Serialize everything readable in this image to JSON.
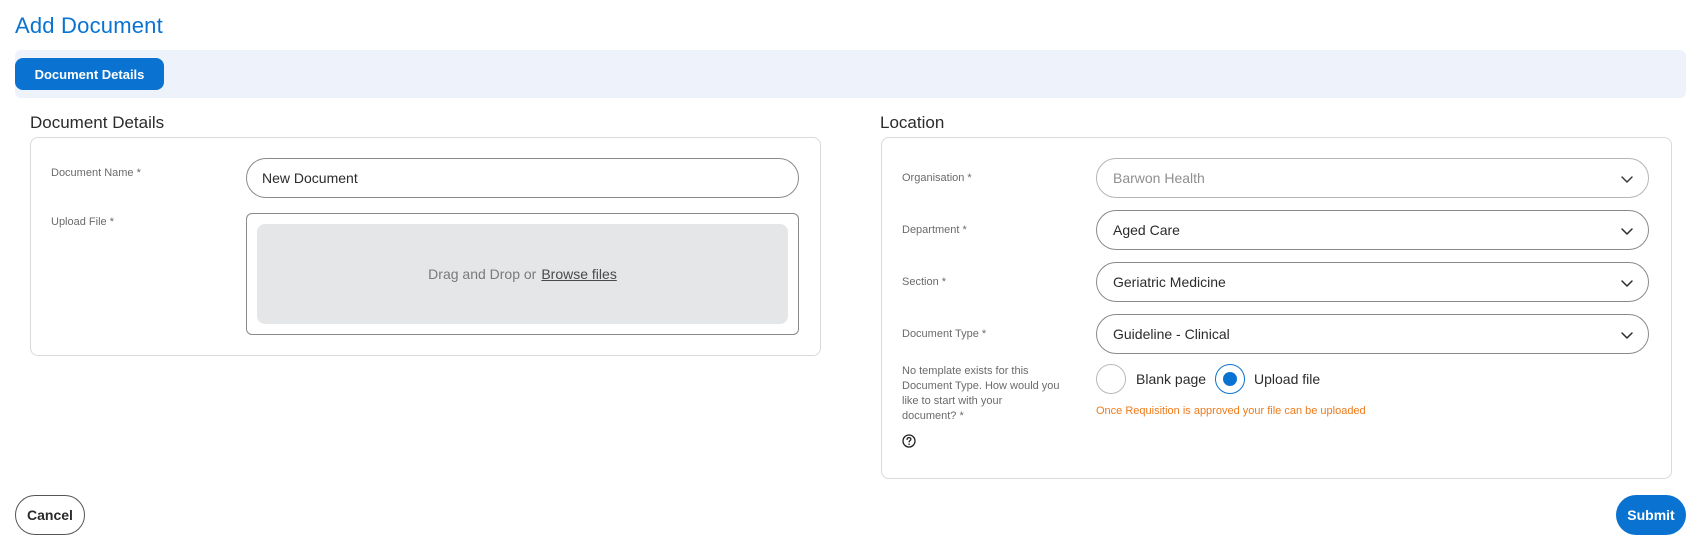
{
  "page": {
    "title": "Add Document"
  },
  "tabs": [
    {
      "label": "Document Details",
      "active": true
    }
  ],
  "document_details": {
    "heading": "Document Details",
    "name_label": "Document Name *",
    "name_value": "New Document",
    "upload_label": "Upload File *",
    "dropzone_text": "Drag and Drop or",
    "browse_link": "Browse files"
  },
  "location": {
    "heading": "Location",
    "organisation": {
      "label": "Organisation *",
      "value": "Barwon Health",
      "disabled": true
    },
    "department": {
      "label": "Department *",
      "value": "Aged Care"
    },
    "section": {
      "label": "Section *",
      "value": "Geriatric Medicine"
    },
    "document_type": {
      "label": "Document Type *",
      "value": "Guideline - Clinical"
    },
    "start_question": {
      "label_lines": [
        "No template exists for this",
        "Document Type. How would you",
        "like to start with your",
        "document? *"
      ],
      "options": [
        {
          "label": "Blank page",
          "selected": false
        },
        {
          "label": "Upload file",
          "selected": true
        }
      ],
      "warning": "Once Requisition is approved your file can be uploaded"
    }
  },
  "icons": {
    "select_chevron": "chevron-down-icon",
    "help": "question-circle-icon"
  },
  "colors": {
    "accent": "#0a73d1",
    "tabbar_bg": "#eef2fa",
    "warning": "#ee7a1a",
    "dropzone_bg": "#e5e6e8"
  },
  "actions": {
    "cancel_label": "Cancel",
    "submit_label": "Submit"
  }
}
